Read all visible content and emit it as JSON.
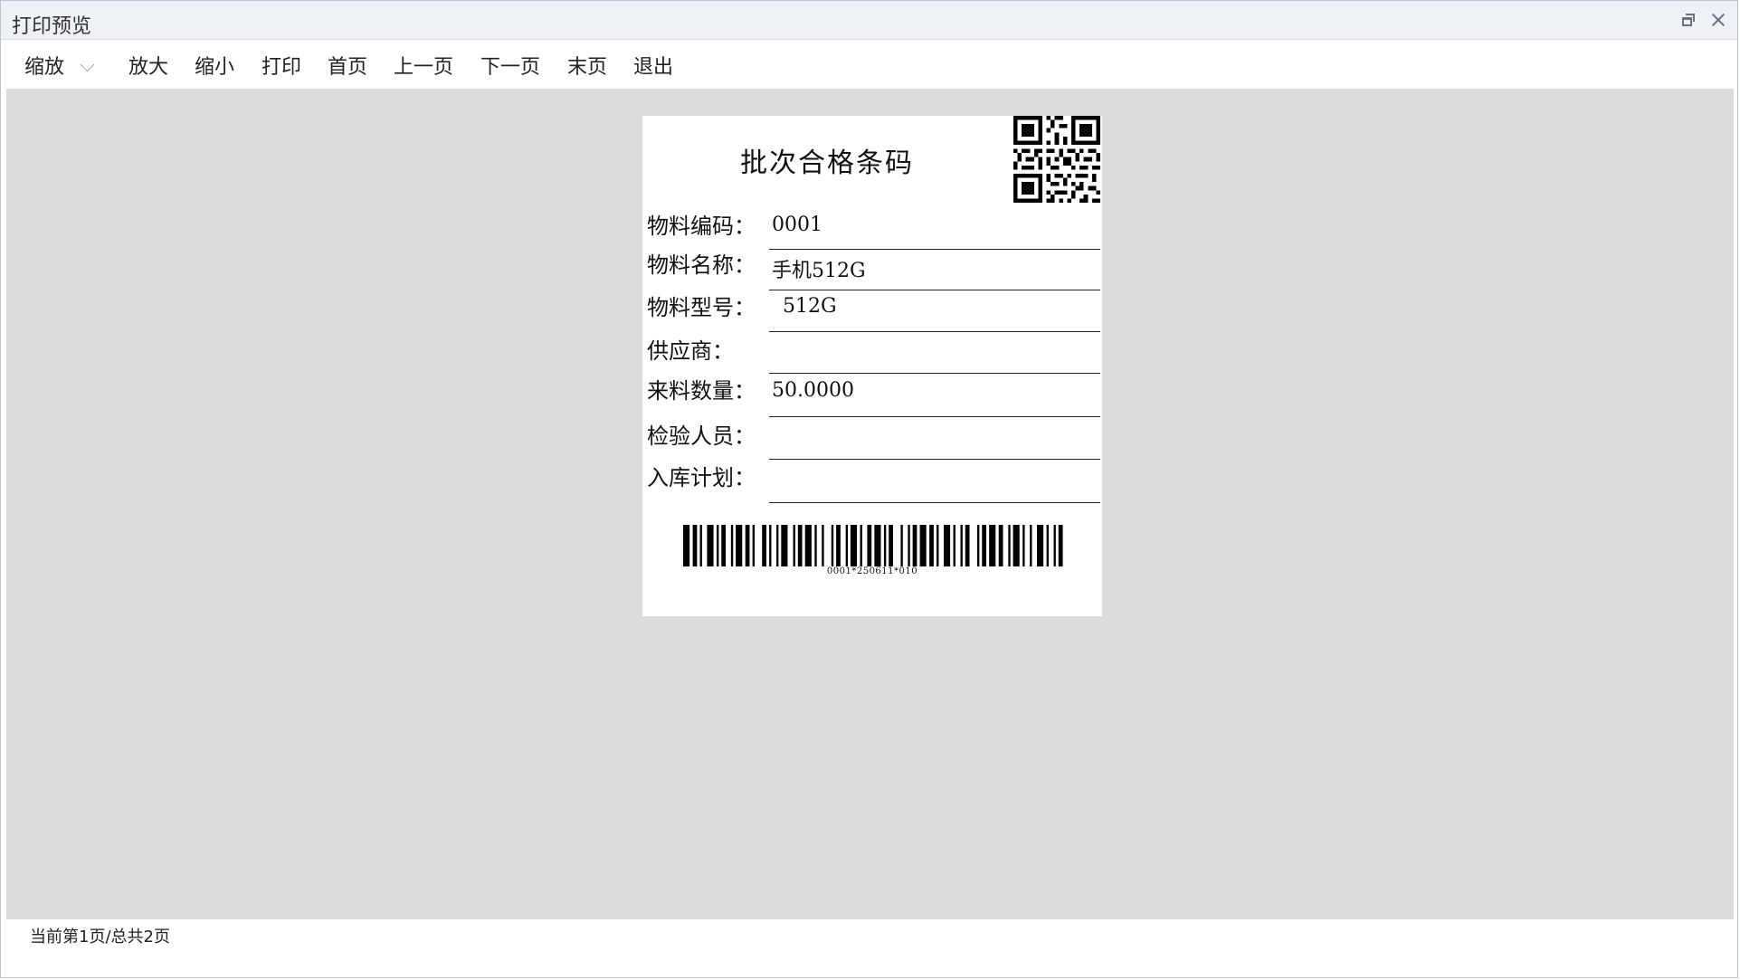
{
  "window": {
    "title": "打印预览",
    "restore_icon": "restore-icon",
    "close_icon": "close-icon"
  },
  "toolbar": {
    "zoom_label": "缩放",
    "zoom_in": "放大",
    "zoom_out": "缩小",
    "print": "打印",
    "first_page": "首页",
    "prev_page": "上一页",
    "next_page": "下一页",
    "last_page": "末页",
    "exit": "退出"
  },
  "label": {
    "title": "批次合格条码",
    "fields": [
      {
        "label": "物料编码：",
        "value": "0001"
      },
      {
        "label": "物料名称：",
        "value": "手机512G"
      },
      {
        "label": "物料型号：",
        "value": "512G"
      },
      {
        "label": "供应商：",
        "value": ""
      },
      {
        "label": "来料数量：",
        "value": "50.0000"
      },
      {
        "label": "检验人员：",
        "value": ""
      },
      {
        "label": "入库计划：",
        "value": ""
      }
    ],
    "barcode_text": "0001*250611*010"
  },
  "status": {
    "page_info": "当前第1页/总共2页"
  }
}
